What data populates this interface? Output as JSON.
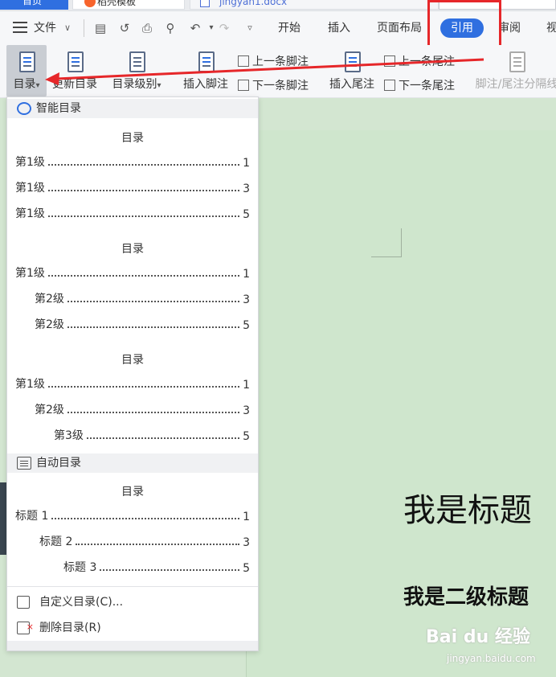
{
  "tabs": {
    "home": "首页",
    "template": "稻壳模板",
    "document": "jingyan1.docx"
  },
  "menubar": {
    "file": "文件",
    "file_arrow": "∨",
    "tabs": {
      "start": "开始",
      "insert": "插入",
      "layout": "页面布局",
      "references": "引用",
      "review": "审阅",
      "view": "视"
    }
  },
  "ribbon": {
    "toc": "目录",
    "toc_arrow": "▾",
    "update_toc": "更新目录",
    "toc_level": "目录级别",
    "toc_level_arrow": "▾",
    "insert_footnote": "插入脚注",
    "prev_footnote": "上一条脚注",
    "next_footnote": "下一条脚注",
    "insert_endnote": "插入尾注",
    "prev_endnote": "上一条尾注",
    "next_endnote": "下一条尾注",
    "footnote_separator": "脚注/尾注分隔线"
  },
  "dropdown": {
    "smart_section": "智能目录",
    "auto_section": "自动目录",
    "toc_title": "目录",
    "smart_tocs": [
      [
        {
          "text": "第1级",
          "page": "1",
          "level": 0
        },
        {
          "text": "第1级",
          "page": "3",
          "level": 0
        },
        {
          "text": "第1级",
          "page": "5",
          "level": 0
        }
      ],
      [
        {
          "text": "第1级",
          "page": "1",
          "level": 0
        },
        {
          "text": "第2级",
          "page": "3",
          "level": 1
        },
        {
          "text": "第2级",
          "page": "5",
          "level": 1
        }
      ],
      [
        {
          "text": "第1级",
          "page": "1",
          "level": 0
        },
        {
          "text": "第2级",
          "page": "3",
          "level": 1
        },
        {
          "text": "第3级",
          "page": "5",
          "level": 2
        }
      ]
    ],
    "auto_toc": [
      {
        "text": "标题 1",
        "page": "1",
        "level": 0
      },
      {
        "text": "标题 2",
        "page": "3",
        "level": 1
      },
      {
        "text": "标题 3",
        "page": "5",
        "level": 2
      }
    ],
    "custom_toc": "自定义目录(C)...",
    "delete_toc": "删除目录(R)"
  },
  "document": {
    "heading1": "我是标题",
    "heading2": "我是二级标题"
  },
  "watermark": {
    "brand": "Bai du 经验",
    "url": "jingyan.baidu.com"
  },
  "colors": {
    "accent": "#2f6fe0",
    "annotation_red": "#e6272a",
    "page_background": "#cfe6cd"
  }
}
